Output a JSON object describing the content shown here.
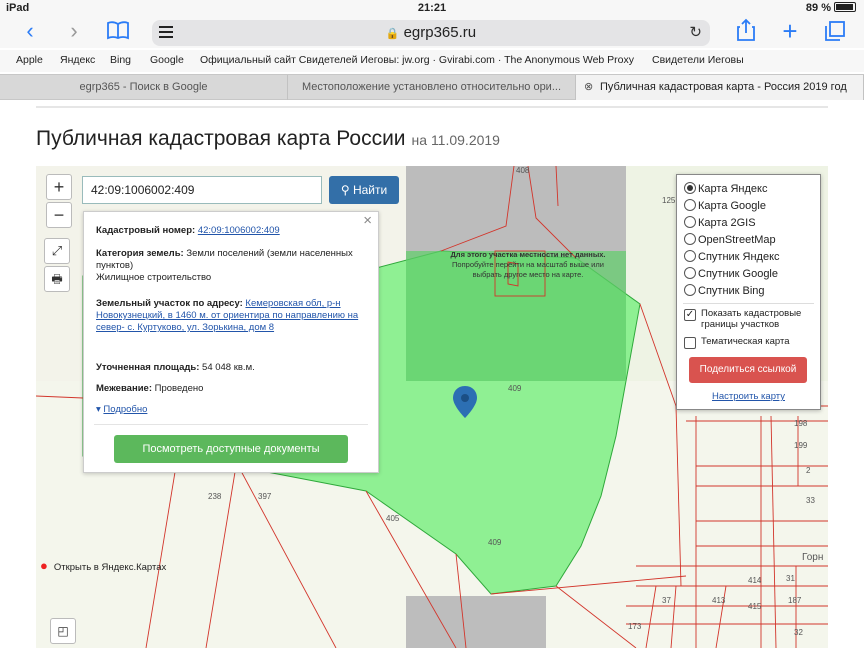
{
  "status_bar": {
    "device": "iPad",
    "time": "21:21",
    "battery": "89 %"
  },
  "browser": {
    "url": "egrp365.ru",
    "bookmarks": [
      "Apple",
      "Яндекс",
      "Bing",
      "Google",
      "Официальный сайт Свидетелей Иеговы: jw.org · Gvirabi.com · The Anonymous Web Proxy",
      "Свидетели Иеговы"
    ],
    "tabs": [
      {
        "title": "egrp365 - Поиск в Google"
      },
      {
        "title": "Местоположение установлено относительно ори..."
      },
      {
        "title": "Публичная кадастровая карта - Россия 2019 год"
      }
    ]
  },
  "page": {
    "title": "Публичная кадастровая карта России",
    "date": "на 11.09.2019"
  },
  "search": {
    "value": "42:09:1006002:409",
    "button": "Найти"
  },
  "info_panel": {
    "cadastral_label": "Кадастровый номер:",
    "cadastral_value": "42:09:1006002:409",
    "category_label": "Категория земель:",
    "category_value": "Земли поселений (земли населенных пунктов)",
    "category_extra": "Жилищное строительство",
    "address_label": "Земельный участок по адресу:",
    "address_value": "Кемеровская обл, р-н Новокузнецкий, в 1460 м. от ориентира по направлению на север- с. Куртуково, ул. Зорькина, дом 8",
    "area_label": "Уточненная площадь:",
    "area_value": "54 048 кв.м.",
    "survey_label": "Межевание:",
    "survey_value": "Проведено",
    "more": "Подробно",
    "docs_button": "Посмотреть доступные документы"
  },
  "layers": {
    "options": [
      "Карта Яндекс",
      "Карта Google",
      "Карта 2GIS",
      "OpenStreetMap",
      "Спутник Яндекс",
      "Спутник Google",
      "Спутник Bing"
    ],
    "selected_index": 0,
    "show_borders": "Показать кадастровые границы участков",
    "show_borders_checked": true,
    "thematic": "Тематическая карта",
    "thematic_checked": false,
    "share": "Поделиться ссылкой",
    "configure": "Настроить карту"
  },
  "map": {
    "no_data_title": "Для этого участка местности нет данных.",
    "no_data_text": "Попробуйте перейти на масштаб выше или выбрать другое место на карте.",
    "open_yandex": "Открыть в Яндекс.Картах",
    "plot_labels": [
      "409",
      "409",
      "405",
      "397",
      "238",
      "408",
      "125",
      "198",
      "199",
      "2",
      "33",
      "414",
      "31",
      "415",
      "187",
      "37",
      "413",
      "173",
      "32",
      "Горн"
    ]
  },
  "colors": {
    "plot_fill": "#7dee84",
    "accent_blue": "#336fa8",
    "button_green": "#5cb85c",
    "button_red": "#d9534f",
    "border_red": "#d2352b"
  }
}
